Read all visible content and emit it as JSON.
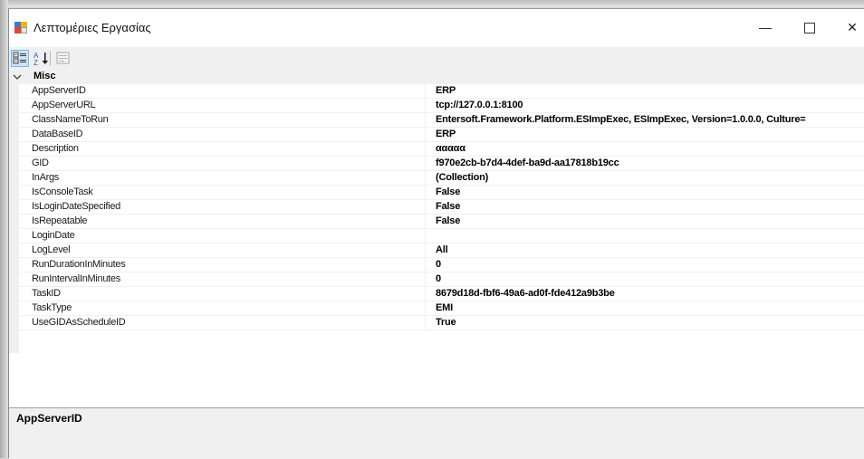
{
  "window": {
    "title": "Λεπτομέριες Εργασίας",
    "minimize": "—",
    "close": "✕"
  },
  "toolbar": {
    "categorized_icon": "categorized-icon",
    "alphabetical_icon": "alphabetical-icon",
    "property_pages_icon": "property-pages-icon"
  },
  "grid": {
    "category": "Misc",
    "rows": [
      {
        "name": "AppServerID",
        "value": "ERP"
      },
      {
        "name": "AppServerURL",
        "value": "tcp://127.0.0.1:8100"
      },
      {
        "name": "ClassNameToRun",
        "value": "Entersoft.Framework.Platform.ESImpExec, ESImpExec, Version=1.0.0.0, Culture="
      },
      {
        "name": "DataBaseID",
        "value": "ERP"
      },
      {
        "name": "Description",
        "value": "ααααα"
      },
      {
        "name": "GID",
        "value": "f970e2cb-b7d4-4def-ba9d-aa17818b19cc"
      },
      {
        "name": "InArgs",
        "value": "(Collection)"
      },
      {
        "name": "IsConsoleTask",
        "value": "False"
      },
      {
        "name": "IsLoginDateSpecified",
        "value": "False"
      },
      {
        "name": "IsRepeatable",
        "value": "False"
      },
      {
        "name": "LoginDate",
        "value": ""
      },
      {
        "name": "LogLevel",
        "value": "All"
      },
      {
        "name": "RunDurationInMinutes",
        "value": "0"
      },
      {
        "name": "RunIntervalInMinutes",
        "value": "0"
      },
      {
        "name": "TaskID",
        "value": "8679d18d-fbf6-49a6-ad0f-fde412a9b3be"
      },
      {
        "name": "TaskType",
        "value": "EMI"
      },
      {
        "name": "UseGIDAsScheduleID",
        "value": "True"
      }
    ]
  },
  "help": {
    "title": "AppServerID"
  },
  "colors": {
    "selected_toolbar_bg": "#cde4f7",
    "category_bg": "#f0f0f0"
  }
}
